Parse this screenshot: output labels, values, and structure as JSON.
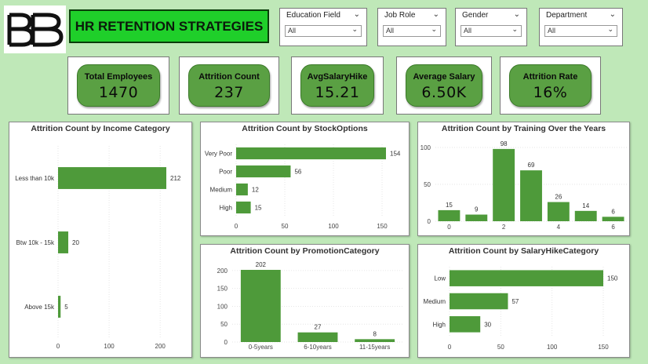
{
  "header": {
    "title": "HR RETENTION STRATEGIES",
    "logo_text": "BB"
  },
  "slicers": [
    {
      "label": "Education Field",
      "value": "All"
    },
    {
      "label": "Job Role",
      "value": "All"
    },
    {
      "label": "Gender",
      "value": "All"
    },
    {
      "label": "Department",
      "value": "All"
    }
  ],
  "kpis": [
    {
      "label": "Total Employees",
      "value": "1470"
    },
    {
      "label": "Attrition Count",
      "value": "237"
    },
    {
      "label": "AvgSalaryHike",
      "value": "15.21"
    },
    {
      "label": "Average Salary",
      "value": "6.50K"
    },
    {
      "label": "Attrition Rate",
      "value": "16%"
    }
  ],
  "colors": {
    "bar": "#4e9a3a",
    "kpi_pill": "#5aa043",
    "title_bg": "#1fcf2a",
    "page_bg": "#bfe8b8"
  },
  "chart_data": [
    {
      "id": "income",
      "type": "bar",
      "orientation": "horizontal",
      "title": "Attrition Count by Income Category",
      "categories": [
        "Less than 10k",
        "Btw 10k - 15k",
        "Above 15k"
      ],
      "values": [
        212,
        20,
        5
      ],
      "xticks": [
        0,
        100,
        200
      ],
      "xlim": [
        0,
        212
      ],
      "grid": true
    },
    {
      "id": "stock",
      "type": "bar",
      "orientation": "horizontal",
      "title": "Attrition Count by StockOptions",
      "categories": [
        "Very Poor",
        "Poor",
        "Medium",
        "High"
      ],
      "values": [
        154,
        56,
        12,
        15
      ],
      "xticks": [
        0,
        50,
        100,
        150
      ],
      "xlim": [
        0,
        154
      ],
      "grid": true
    },
    {
      "id": "training",
      "type": "bar",
      "orientation": "vertical",
      "title": "Attrition Count by Training Over the Years",
      "categories": [
        "0",
        "1",
        "2",
        "3",
        "4",
        "5",
        "6"
      ],
      "values": [
        15,
        9,
        98,
        69,
        26,
        14,
        6
      ],
      "xticks": [
        "0",
        "2",
        "4",
        "6"
      ],
      "yticks": [
        0,
        50,
        100
      ],
      "ylim": [
        0,
        100
      ],
      "grid": true
    },
    {
      "id": "promotion",
      "type": "bar",
      "orientation": "vertical",
      "title": "Attrition Count by PromotionCategory",
      "categories": [
        "0-5years",
        "6-10years",
        "11-15years"
      ],
      "values": [
        202,
        27,
        8
      ],
      "yticks": [
        0,
        50,
        100,
        150,
        200
      ],
      "ylim": [
        0,
        202
      ],
      "grid": true
    },
    {
      "id": "salaryhike",
      "type": "bar",
      "orientation": "horizontal",
      "title": "Attrition Count by SalaryHikeCategory",
      "categories": [
        "Low",
        "Medium",
        "High"
      ],
      "values": [
        150,
        57,
        30
      ],
      "xticks": [
        0,
        50,
        100,
        150
      ],
      "xlim": [
        0,
        150
      ],
      "grid": true
    }
  ]
}
